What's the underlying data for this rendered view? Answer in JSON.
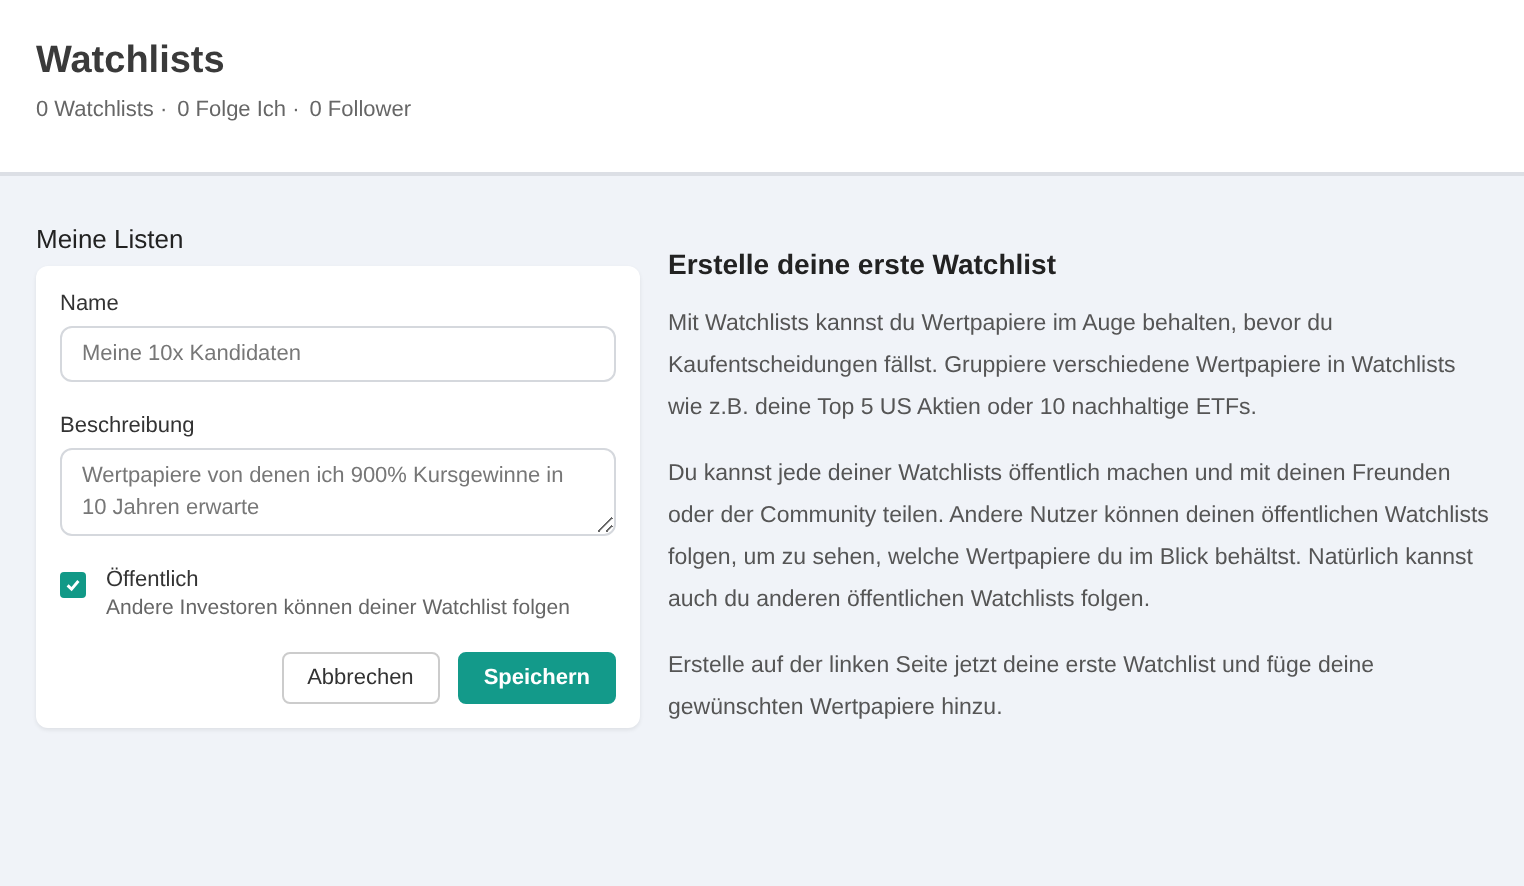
{
  "header": {
    "title": "Watchlists",
    "stats": [
      "0 Watchlists ·",
      "0 Folge Ich ·",
      "0 Follower"
    ]
  },
  "section_title": "Meine Listen",
  "form": {
    "name_label": "Name",
    "name_placeholder": "Meine 10x Kandidaten",
    "description_label": "Beschreibung",
    "description_placeholder": "Wertpapiere von denen ich 900% Kursgewinne in 10 Jahren erwarte",
    "public": {
      "label": "Öffentlich",
      "hint": "Andere Investoren können deiner Watchlist folgen",
      "checked": true
    },
    "cancel": "Abbrechen",
    "save": "Speichern"
  },
  "info": {
    "title": "Erstelle deine erste Watchlist",
    "paragraphs": [
      "Mit Watchlists kannst du Wertpapiere im Auge behalten, bevor du Kaufentscheidungen fällst. Gruppiere verschiedene Wertpapiere in Watchlists wie z.B. deine Top 5 US Aktien oder 10 nachhaltige ETFs.",
      "Du kannst jede deiner Watchlists öffentlich machen und mit deinen Freunden oder der Community teilen. Andere Nutzer können deinen öffentlichen Watchlists folgen, um zu sehen, welche Wertpapiere du im Blick behältst. Natürlich kannst auch du anderen öffentlichen Watchlists folgen.",
      "Erstelle auf der linken Seite jetzt deine erste Watchlist und füge deine gewünschten Wertpapiere hinzu."
    ]
  }
}
